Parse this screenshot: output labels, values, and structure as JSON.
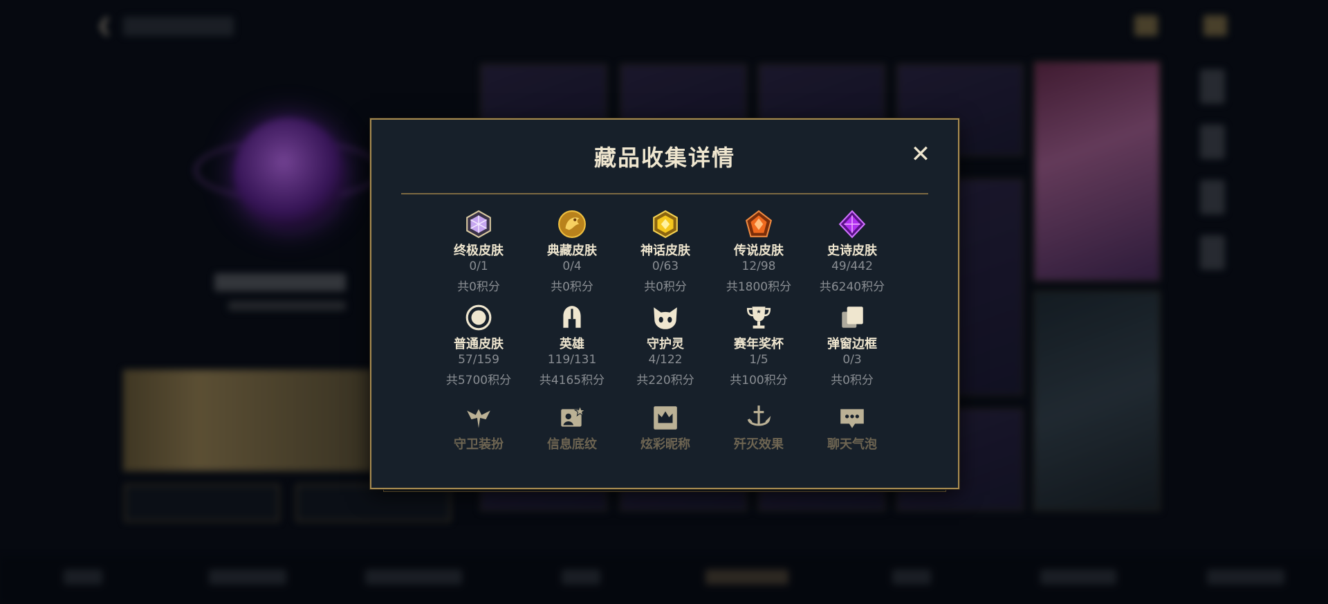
{
  "modal": {
    "title": "藏品收集详情",
    "close_label": "✕"
  },
  "collections": [
    {
      "icon": "ultimate-skin-icon",
      "name": "终极皮肤",
      "count": "0/1",
      "points": "共0积分"
    },
    {
      "icon": "collector-skin-icon",
      "name": "典藏皮肤",
      "count": "0/4",
      "points": "共0积分"
    },
    {
      "icon": "mythic-skin-icon",
      "name": "神话皮肤",
      "count": "0/63",
      "points": "共0积分"
    },
    {
      "icon": "legendary-skin-icon",
      "name": "传说皮肤",
      "count": "12/98",
      "points": "共1800积分"
    },
    {
      "icon": "epic-skin-icon",
      "name": "史诗皮肤",
      "count": "49/442",
      "points": "共6240积分"
    },
    {
      "icon": "normal-skin-icon",
      "name": "普通皮肤",
      "count": "57/159",
      "points": "共5700积分"
    },
    {
      "icon": "hero-helmet-icon",
      "name": "英雄",
      "count": "119/131",
      "points": "共4165积分"
    },
    {
      "icon": "guardian-spirit-icon",
      "name": "守护灵",
      "count": "4/122",
      "points": "共220积分"
    },
    {
      "icon": "trophy-icon",
      "name": "赛年奖杯",
      "count": "1/5",
      "points": "共100积分"
    },
    {
      "icon": "popup-frame-icon",
      "name": "弹窗边框",
      "count": "0/3",
      "points": "共0积分"
    },
    {
      "icon": "guardian-outfit-icon",
      "name": "守卫装扮"
    },
    {
      "icon": "info-pattern-icon",
      "name": "信息底纹"
    },
    {
      "icon": "colorful-nickname-icon",
      "name": "炫彩昵称"
    },
    {
      "icon": "annihilation-effect-icon",
      "name": "歼灭效果"
    },
    {
      "icon": "chat-bubble-icon",
      "name": "聊天气泡"
    }
  ],
  "colors": {
    "gold": "#a68a50",
    "title": "#efe6cf",
    "muted": "#8a8e93",
    "panel": "#17202a"
  }
}
